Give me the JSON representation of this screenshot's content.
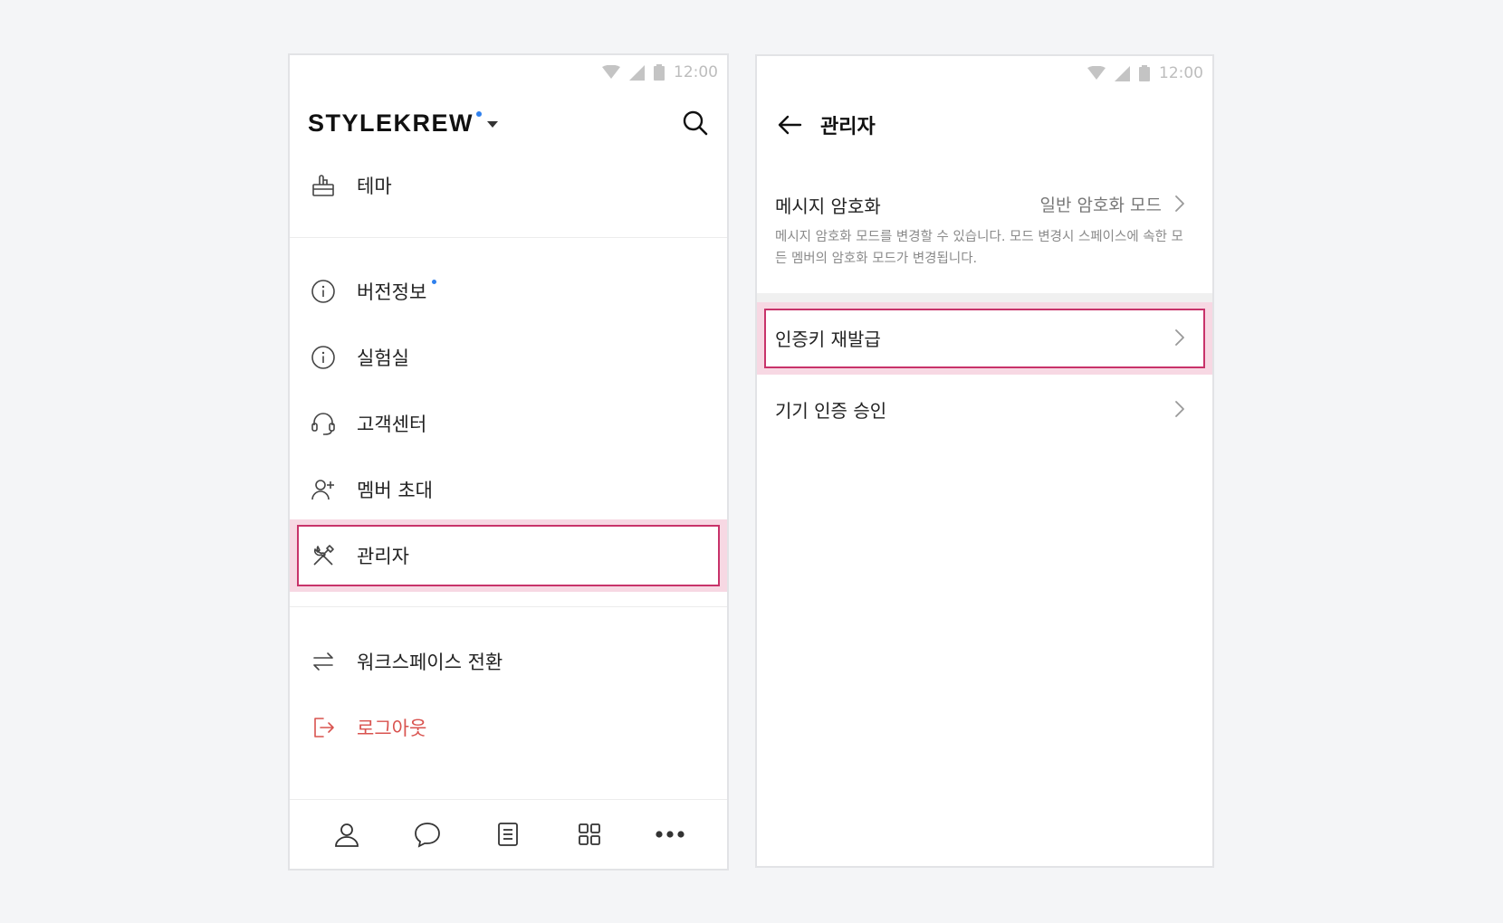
{
  "status_bar": {
    "time": "12:00"
  },
  "left_screen": {
    "logo": "STYLEKREW",
    "menu": {
      "theme": "테마",
      "version": "버전정보",
      "lab": "실험실",
      "support": "고객센터",
      "invite": "멤버 초대",
      "admin": "관리자",
      "switch_workspace": "워크스페이스 전환",
      "logout": "로그아웃"
    },
    "colors": {
      "logout": "#d9534f",
      "highlight": "#c8336a",
      "new_dot": "#2f80ed"
    },
    "tabbar_icons": [
      "person-icon",
      "chat-bubble-icon",
      "document-icon",
      "grid-icon",
      "more-icon"
    ]
  },
  "right_screen": {
    "title": "관리자",
    "rows": {
      "encryption": {
        "title": "메시지 암호화",
        "value": "일반 암호화 모드",
        "description": "메시지 암호화 모드를 변경할 수 있습니다. 모드 변경시 스페이스에 속한 모든 멤버의 암호화 모드가 변경됩니다."
      },
      "reissue_key": {
        "title": "인증키 재발급"
      },
      "device_auth": {
        "title": "기기 인증 승인"
      }
    }
  }
}
